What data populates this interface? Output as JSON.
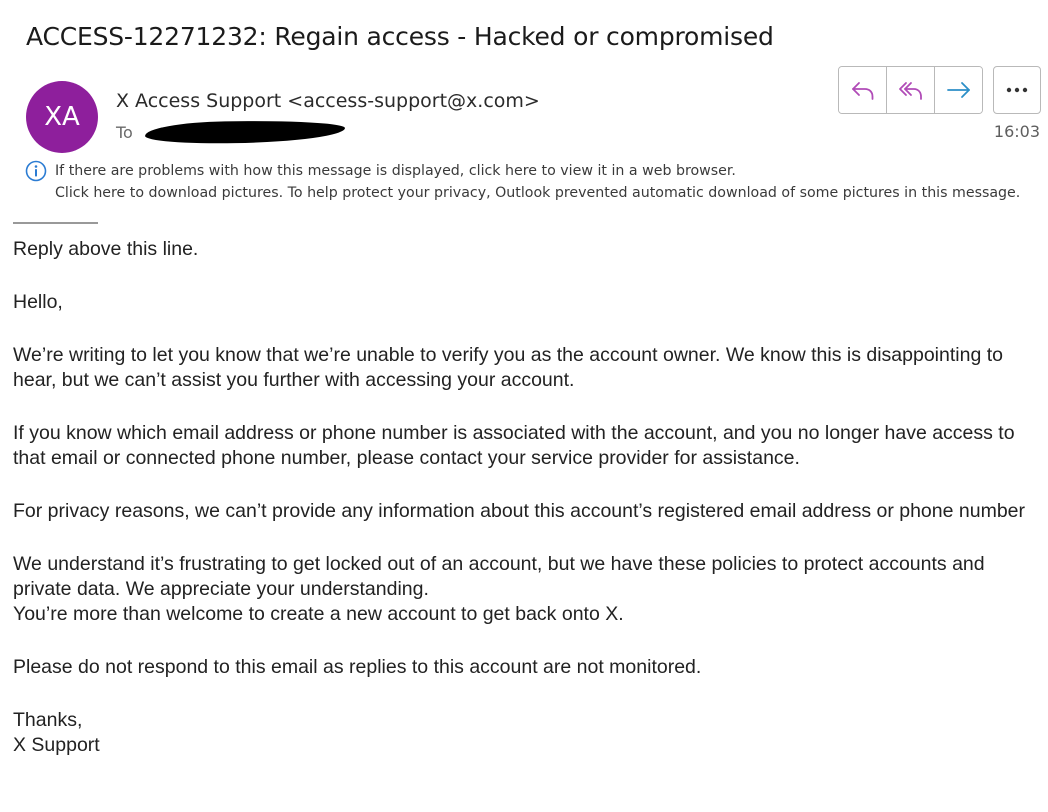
{
  "message": {
    "subject": "ACCESS-12271232: Regain access - Hacked or compromised",
    "avatar_initials": "XA",
    "avatar_color": "#8e1f9c",
    "sender": "X Access Support <access-support@x.com>",
    "to_label": "To",
    "time": "16:03"
  },
  "toolbar": {
    "reply_icon": "reply-icon",
    "reply_all_icon": "reply-all-icon",
    "forward_icon": "forward-icon",
    "more_icon": "more-options-icon"
  },
  "notices": {
    "line1": "If there are problems with how this message is displayed, click here to view it in a web browser.",
    "line2": "Click here to download pictures. To help protect your privacy, Outlook prevented automatic download of some pictures in this message."
  },
  "body": {
    "separator": "——————",
    "reply_above": "Reply above this line.",
    "greeting": "Hello,",
    "para1": "We’re writing to let you know that we’re unable to verify you as the account owner. We know this is disappointing to hear, but we can’t assist you further with accessing your account.",
    "para2": "If you know which email address or phone number is associated with the account, and you no longer have access to that email or connected phone number, please contact your service provider for assistance.",
    "para3": "For privacy reasons, we can’t provide any information about this account’s registered email address or phone number",
    "para4a": "We understand it’s frustrating to get locked out of an account, but we have these policies to protect accounts and private data. We appreciate your understanding.",
    "para4b": "You’re more than welcome to create a new account to get back onto X.",
    "para5": "Please do not respond to this email as replies to this account are not monitored.",
    "closing": "Thanks,",
    "signature": "X Support"
  }
}
